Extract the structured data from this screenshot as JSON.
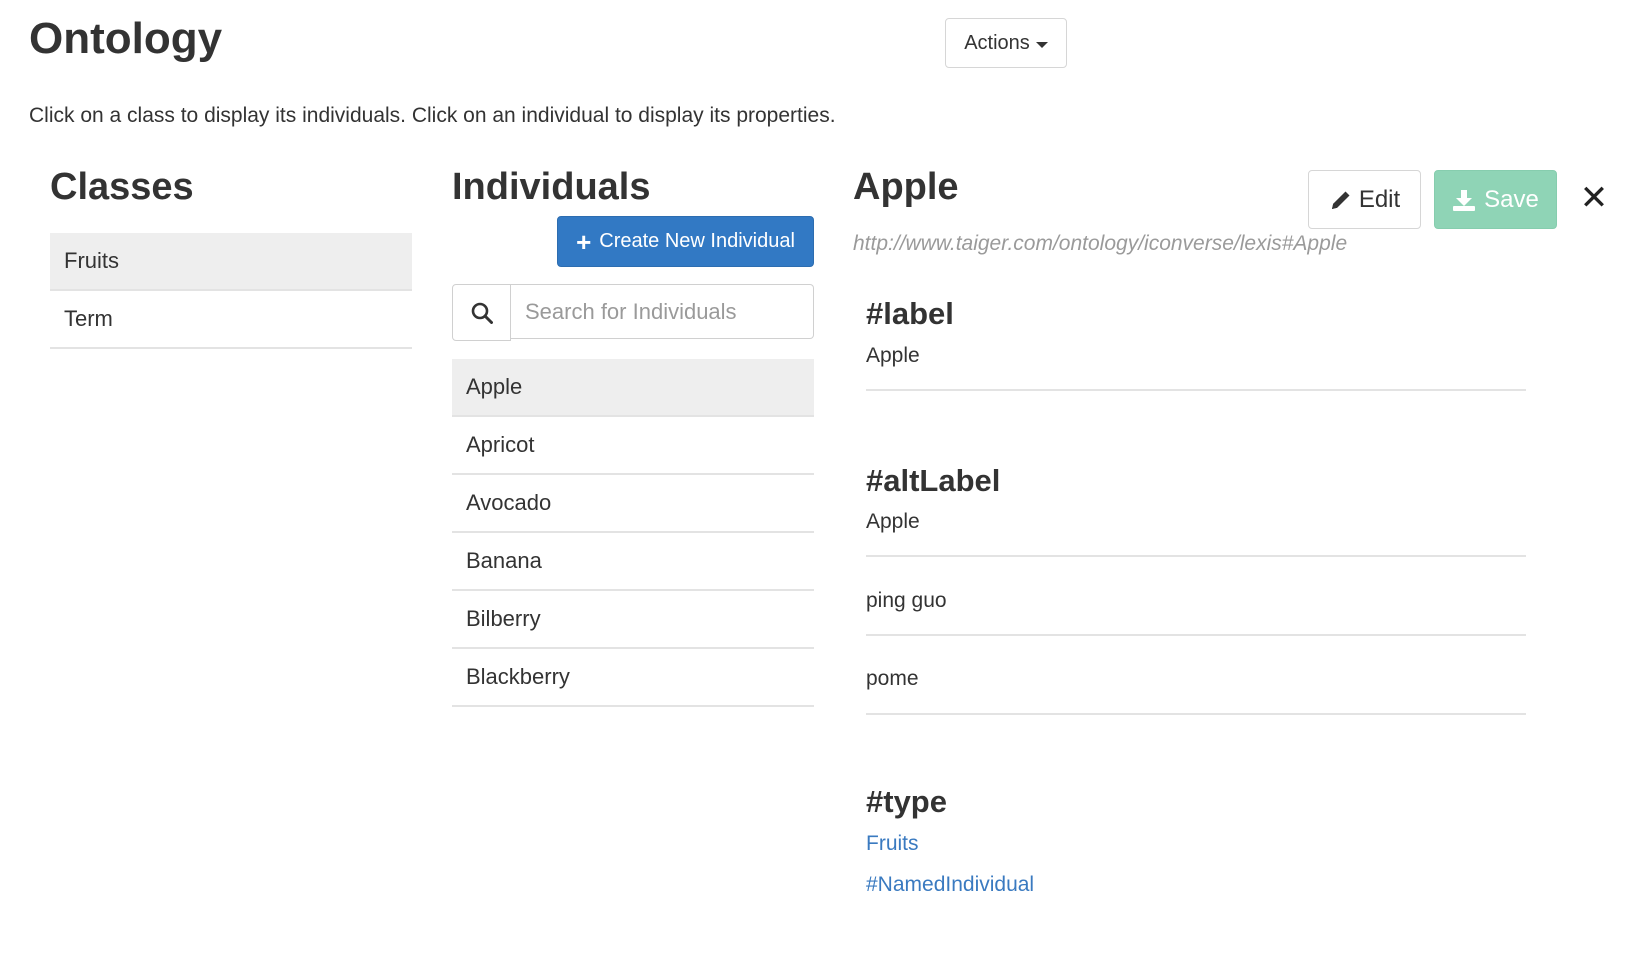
{
  "page": {
    "title": "Ontology",
    "actions_label": "Actions",
    "instructions": "Click on a class to display its individuals. Click on an individual to display its properties."
  },
  "classes": {
    "title": "Classes",
    "selected": "Fruits",
    "items": [
      {
        "label": "Fruits"
      },
      {
        "label": "Term"
      }
    ]
  },
  "individuals": {
    "title": "Individuals",
    "create_label": "Create New Individual",
    "search_placeholder": "Search for Individuals",
    "search_value": "",
    "selected": "Apple",
    "items": [
      {
        "label": "Apple"
      },
      {
        "label": "Apricot"
      },
      {
        "label": "Avocado"
      },
      {
        "label": "Banana"
      },
      {
        "label": "Bilberry"
      },
      {
        "label": "Blackberry"
      }
    ]
  },
  "detail": {
    "title": "Apple",
    "uri": "http://www.taiger.com/ontology/iconverse/lexis#Apple",
    "edit_label": "Edit",
    "save_label": "Save",
    "close_symbol": "✕",
    "properties": {
      "label": {
        "heading": "#label",
        "values": [
          "Apple"
        ]
      },
      "altLabel": {
        "heading": "#altLabel",
        "values": [
          "Apple",
          "ping guo",
          "pome"
        ]
      },
      "type": {
        "heading": "#type",
        "links": [
          "Fruits",
          "#NamedIndividual"
        ]
      }
    }
  },
  "colors": {
    "primary": "#3279c4",
    "save_disabled": "#8fd4b6",
    "link": "#3a7ac0",
    "active_row": "#eeeeee",
    "divider": "#e3e3e3"
  },
  "icons": {
    "actions": "caret-down-icon",
    "create": "plus-icon",
    "search": "search-icon",
    "edit": "pencil-icon",
    "save": "download-icon",
    "close": "close-icon"
  }
}
